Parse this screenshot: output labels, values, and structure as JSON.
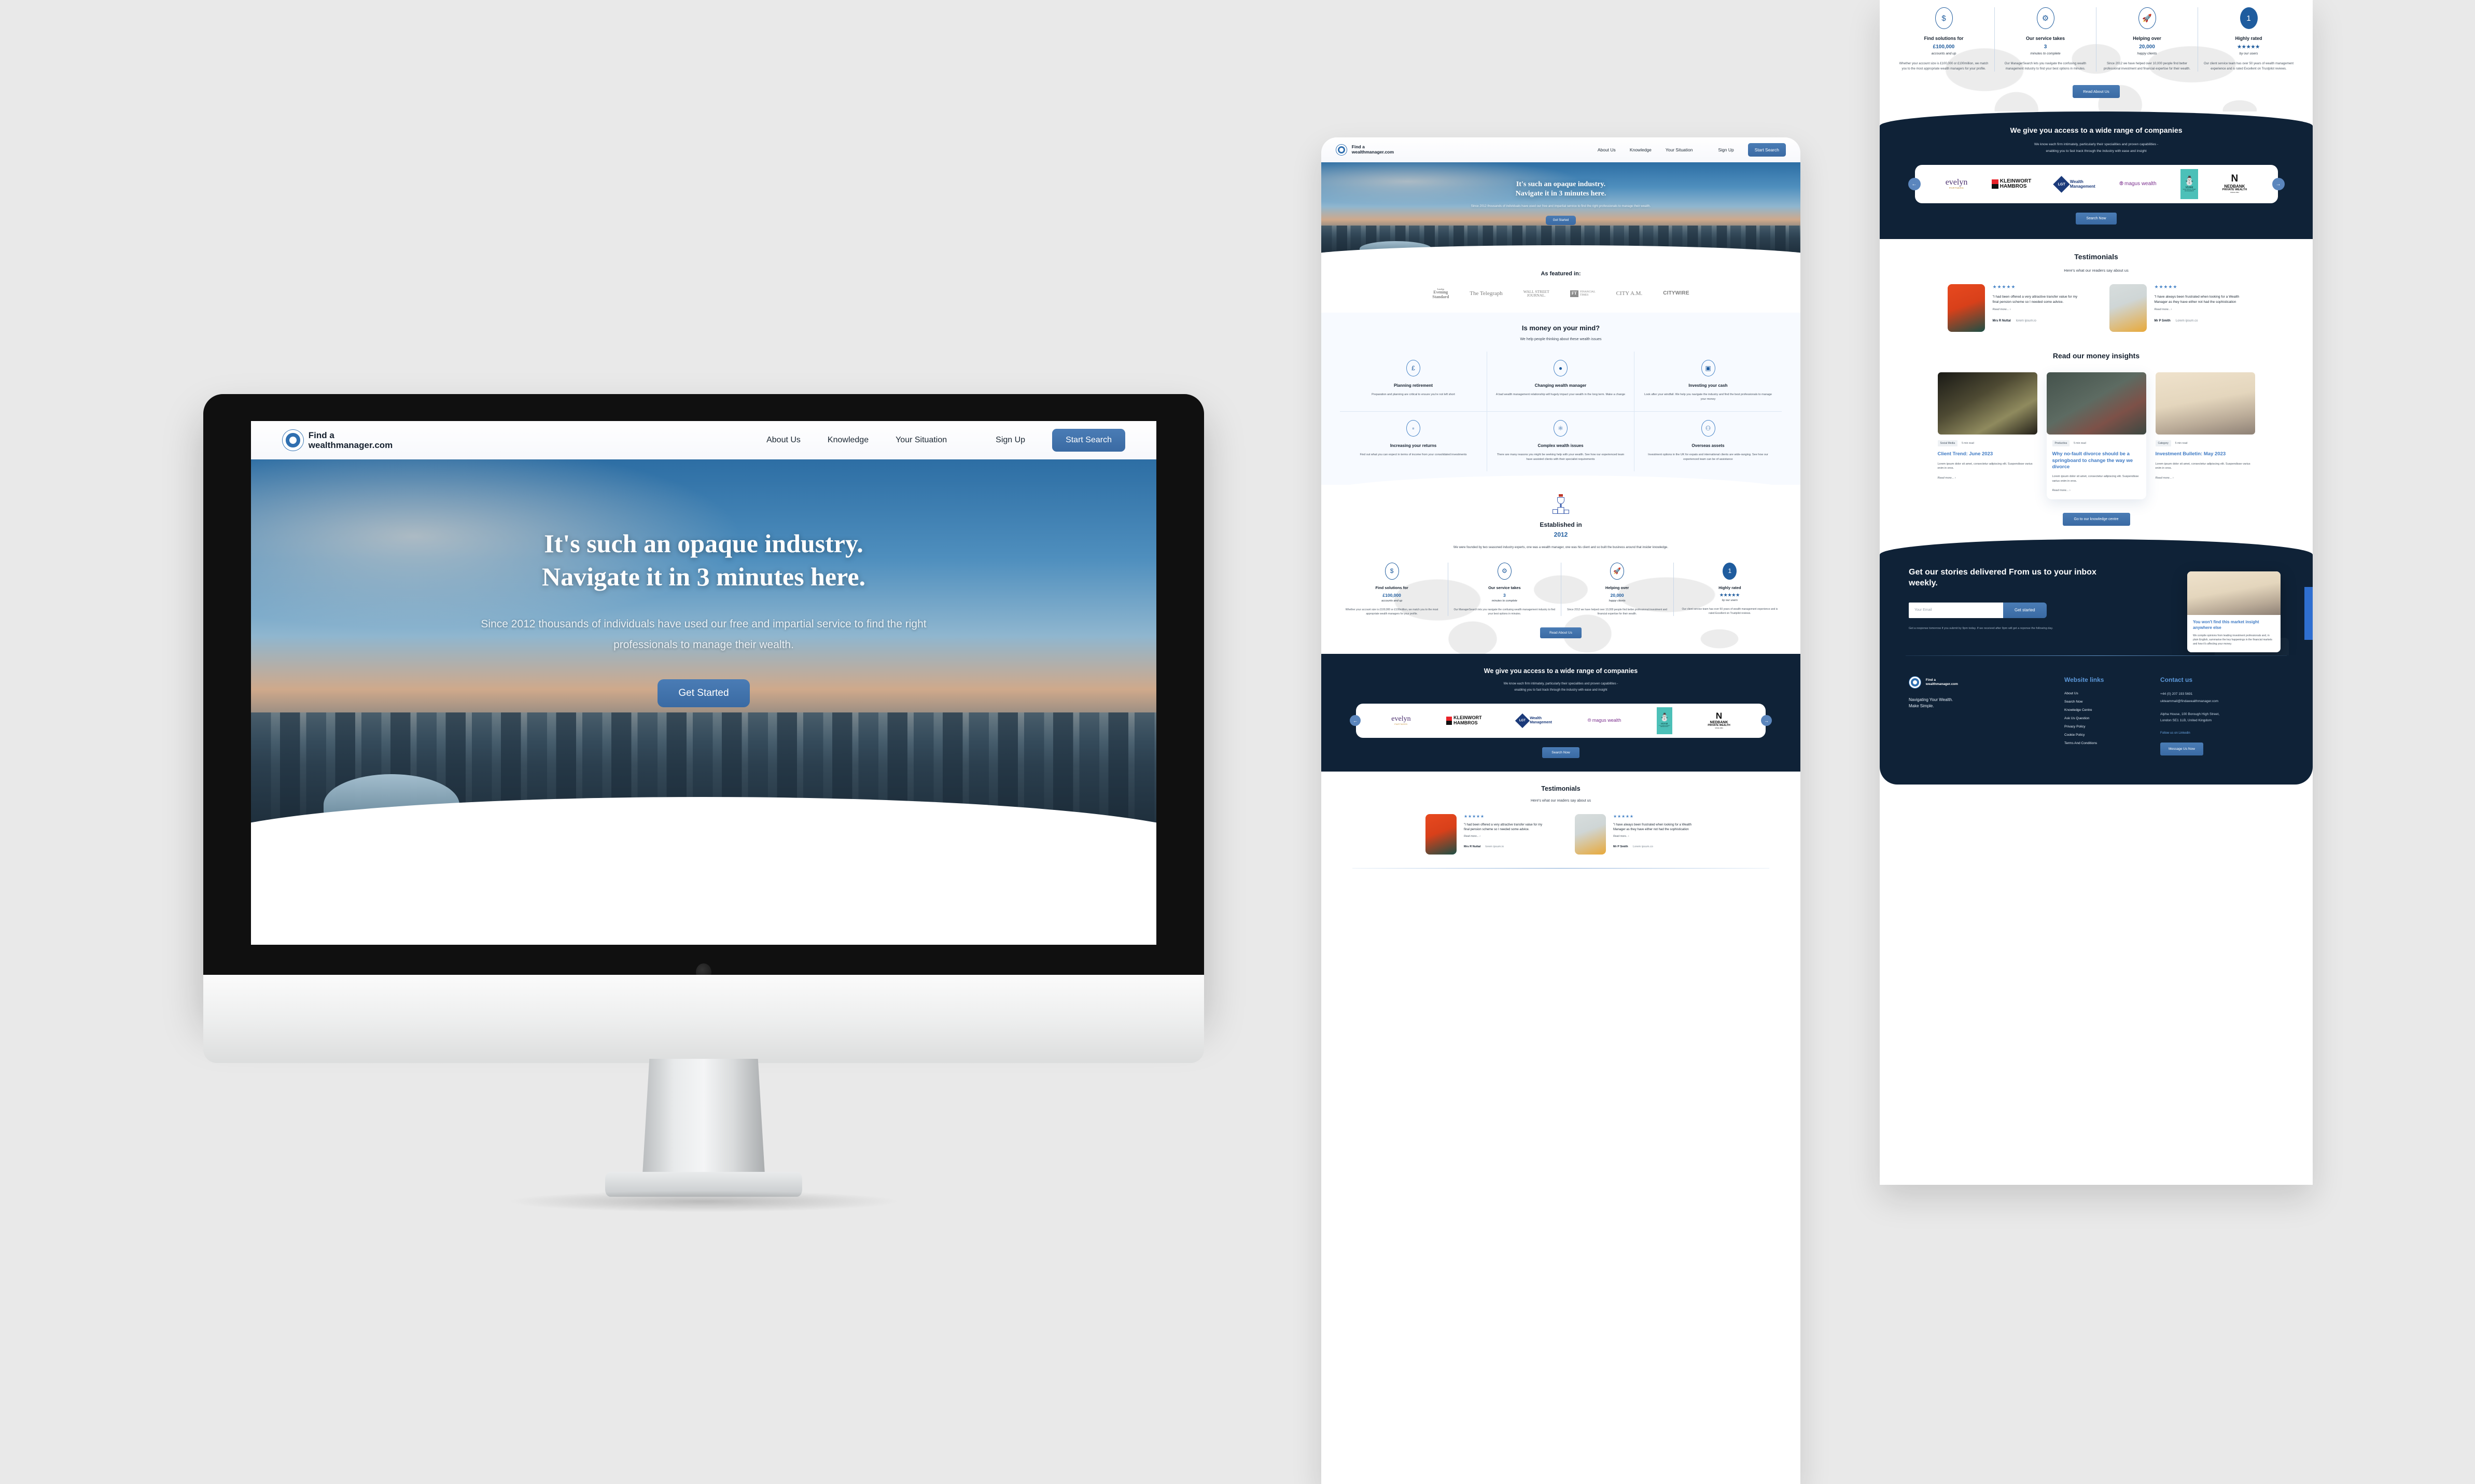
{
  "brand": {
    "line1": "Find a",
    "line2": "wealthmanager.com",
    "footer_tagline": "Navigating Your Wealth.\nMake Simple."
  },
  "nav": {
    "links": [
      "About Us",
      "Knowledge",
      "Your Situation"
    ],
    "signup": "Sign Up",
    "cta": "Start Search"
  },
  "hero": {
    "headline_line1": "It's such an opaque industry.",
    "headline_line2": "Navigate it in 3 minutes here.",
    "subline": "Since 2012 thousands of individuals have used our free and impartial service to find the right professionals to manage their wealth.",
    "cta": "Get Started"
  },
  "featured": {
    "title": "As featured in:",
    "logos": [
      {
        "top": "London",
        "main": "Evening",
        "sub": "Standard",
        "style": "serif"
      },
      {
        "top": "",
        "main": "The Telegraph",
        "sub": "",
        "style": "serif"
      },
      {
        "top": "",
        "main": "WALL STREET",
        "sub": "JOURNAL.",
        "style": "serif"
      },
      {
        "top": "FT",
        "main": "FINANCIAL",
        "sub": "TIMES",
        "style": "ft"
      },
      {
        "top": "",
        "main": "CITY A.M.",
        "sub": "",
        "style": "serif"
      },
      {
        "top": "",
        "main": "CITYWIRE",
        "sub": "",
        "style": "sans"
      }
    ]
  },
  "money": {
    "title": "Is money on your mind?",
    "subtitle": "We help people thinking about these wealth issues",
    "cards": [
      {
        "icon": "coins-pound-icon",
        "glyph": "£",
        "title": "Planning retirement",
        "body": "Preparation and planning are critical to ensure you're not left short"
      },
      {
        "icon": "person-manager-icon",
        "glyph": "●",
        "title": "Changing wealth manager",
        "body": "A bad wealth management relationship will hugely impact your wealth in the long term. Make a change"
      },
      {
        "icon": "cash-screen-icon",
        "glyph": "▣",
        "title": "Investing your cash",
        "body": "Look after your windfall. We help you navigate the industry and find the best professionals to manage your money"
      },
      {
        "icon": "growth-chart-icon",
        "glyph": "▫",
        "title": "Increasing your returns",
        "body": "Find out what you can expect in terms of income from your consolidated investments"
      },
      {
        "icon": "atom-pound-icon",
        "glyph": "⚛",
        "title": "Complex wealth issues",
        "body": "There are many reasons you might be seeking help with your wealth. See how our experienced team have assisted clients with their specialist requirements"
      },
      {
        "icon": "globe-people-icon",
        "glyph": "⚇",
        "title": "Overseas assets",
        "body": "Investment options in the UK for expats and international clients are wide-ranging. See how our experienced team can be of assistance"
      }
    ]
  },
  "established": {
    "icon": "trophy-podium-icon",
    "title": "Established in",
    "year": "2012",
    "body": "We were founded by two seasoned industry experts, one was a wealth manager, one was his client and so built the business around that insider knowledge.",
    "stats": [
      {
        "icon": "lightbulb-dollar-icon",
        "label": "Find solutions for",
        "value": "£100,000",
        "unit": "accounts and up",
        "desc": "Whether your account size is £100,000 or £100million, we match you to the most appropriate wealth managers for your profile."
      },
      {
        "icon": "clock-gear-icon",
        "label": "Our service takes",
        "value": "3",
        "unit": "minutes to complete",
        "desc": "Our ManagerSearch lets you navigate the confusing wealth management industry to find your best options in minutes."
      },
      {
        "icon": "rocket-icon",
        "label": "Helping over",
        "value": "20,000",
        "unit": "happy clients",
        "desc": "Since 2012 we have helped over 10,000 people find better professional investment and financial expertise for their wealth."
      },
      {
        "icon": "shield-badge-icon",
        "label": "Highly rated",
        "value": "★★★★★",
        "unit": "by our users",
        "desc": "Our client service team has over 50 years of wealth management experience and is rated Excellent on Trustpilot reviews."
      }
    ],
    "cta": "Read About Us"
  },
  "companies": {
    "title": "We give you access to a wide range of companies",
    "sub_line1": "We know each firm intimately, particularly their specialities and proven capabilities -",
    "sub_line2": "enabling you to fast track through the industry with ease and insight",
    "prev_icon": "arrow-left-icon",
    "next_icon": "arrow-right-icon",
    "logos": [
      {
        "main": "evelyn",
        "sub": "PARTNERS",
        "kind": "evelyn"
      },
      {
        "main": "KLEINWORT",
        "sub": "HAMBROS",
        "kind": "kleinwort"
      },
      {
        "main": "Wealth",
        "sub": "Management",
        "kind": "lgt",
        "badge": "LGT"
      },
      {
        "main": "magus wealth",
        "sub": "",
        "kind": "magus"
      },
      {
        "main": "MVAM",
        "sub": "VOLE VALLEY ASSET MANAGEMENT",
        "kind": "mvam"
      },
      {
        "main": "NEDBANK",
        "sub": "PRIVATE WEALTH",
        "kind": "nedbank",
        "badge": "SINCE 1894"
      }
    ],
    "cta": "Search Now"
  },
  "testimonials": {
    "title": "Testimonials",
    "subtitle": "Here's what our readers say about us",
    "items": [
      {
        "stars": "★★★★★",
        "quote": "\"I had been offered a very attractive transfer value for my final pension scheme so I needed some advice.",
        "read_more": "Read more... ›",
        "name": "Mrs R Nuttal",
        "site": "lorem ipsum.io",
        "photo": "a"
      },
      {
        "stars": "★★★★★",
        "quote": "\"I have always been frustrated when looking for a Wealth Manager as they have either not had the sophistication",
        "read_more": "Read more.. ›",
        "name": "Mr P Smith",
        "site": "Lorem ipsum.co",
        "photo": "b"
      }
    ]
  },
  "insights": {
    "title": "Read our money insights",
    "cards": [
      {
        "tag": "Social Media",
        "read_time": "5 min read",
        "title": "Client Trend: June 2023",
        "body": "Lorem ipsum dolor sit amet, consectetur adipiscing elit. Suspendisse varius enim in eros.",
        "more": "Read more... ›",
        "img": "a"
      },
      {
        "tag": "Productiva",
        "read_time": "5 min read",
        "title": "Why no-fault divorce should be a springboard to change the way we divorce",
        "body": "Lorem ipsum dolor sit amet, consectetur adipiscing elit. Suspendisse varius enim in eros.",
        "more": "Read more... ›",
        "img": "b"
      },
      {
        "tag": "Category",
        "read_time": "5 min read",
        "title": "Investment Bulletin: May 2023",
        "body": "Lorem ipsum dolor sit amet, consectetur adipiscing elit. Suspendisse varius enim in eros.",
        "more": "Read more... ›",
        "img": "c"
      }
    ],
    "cta": "Go to our knowledge centre"
  },
  "newsletter": {
    "heading": "Get our stories delivered From us to your inbox weekly.",
    "placeholder": "Your Email",
    "cta": "Get started",
    "note": "Get a response tomorrow if you submit by 9pm today. If we received after 9pm will get a reponse the following day.",
    "card_title": "You won't find this market insight anywhere else",
    "card_body": "We compile opinions from leading investment professionals and, in plain English, summarise the key happenings in the financial markets and how it's affecting your money."
  },
  "footer": {
    "links_title": "Website links",
    "links": [
      "About  Us",
      "Search Now",
      "Knowledge Centre",
      "Ask Us Question",
      "Privacy Policy",
      "Cookie Policy",
      "Terms And Conditions"
    ],
    "contact_title": "Contact us",
    "phone": "+44 (0) 207 193 5691",
    "email": "ukteammail@findawealthmanager.com",
    "address_line1": "Alpha House, 100 Borough High Street,",
    "address_line2": "London SE1 1LB, United Kingdom",
    "social": "Follow us on Linkedin",
    "cta": "Message Us Now"
  },
  "colors": {
    "accent_blue": "#3a6aa3",
    "link_blue": "#3e7ac4",
    "dark_navy": "#0f2237",
    "canvas": "#e9e9e9"
  }
}
